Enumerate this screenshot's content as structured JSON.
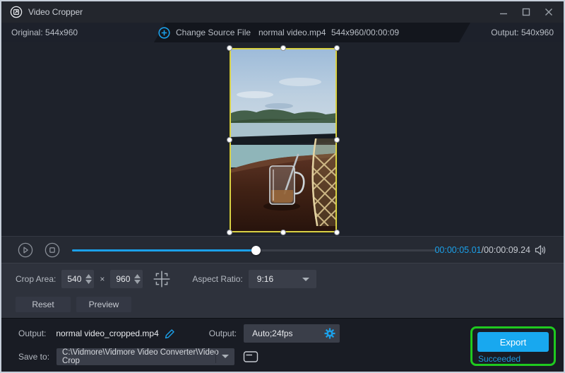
{
  "window": {
    "title": "Video Cropper"
  },
  "info_bar": {
    "original_label": "Original: 544x960",
    "change_source_label": "Change Source File",
    "file_name": "normal video.mp4",
    "file_meta": "544x960/00:00:09",
    "output_label": "Output: 540x960"
  },
  "playback": {
    "current_time": "00:00:05.01",
    "total_time": "/00:00:09.24",
    "progress_percent": 50.3
  },
  "crop_controls": {
    "crop_area_label": "Crop Area:",
    "width_value": "540",
    "multiply_sign": "×",
    "height_value": "960",
    "aspect_ratio_label": "Aspect Ratio:",
    "aspect_ratio_value": "9:16"
  },
  "actions": {
    "reset_label": "Reset",
    "preview_label": "Preview"
  },
  "output_section": {
    "output_name_label": "Output:",
    "output_name_value": "normal video_cropped.mp4",
    "output_format_label": "Output:",
    "output_format_value": "Auto;24fps",
    "save_to_label": "Save to:",
    "save_to_value": "C:\\Vidmore\\Vidmore Video Converter\\Video Crop",
    "export_label": "Export",
    "status_text": "Succeeded"
  },
  "colors": {
    "accent_blue": "#1ba0e9",
    "crop_border_yellow": "#d8d044",
    "highlight_green": "#1fc91f",
    "export_button_blue": "#18a8ef",
    "succeeded_text_blue": "#1e9be0"
  }
}
